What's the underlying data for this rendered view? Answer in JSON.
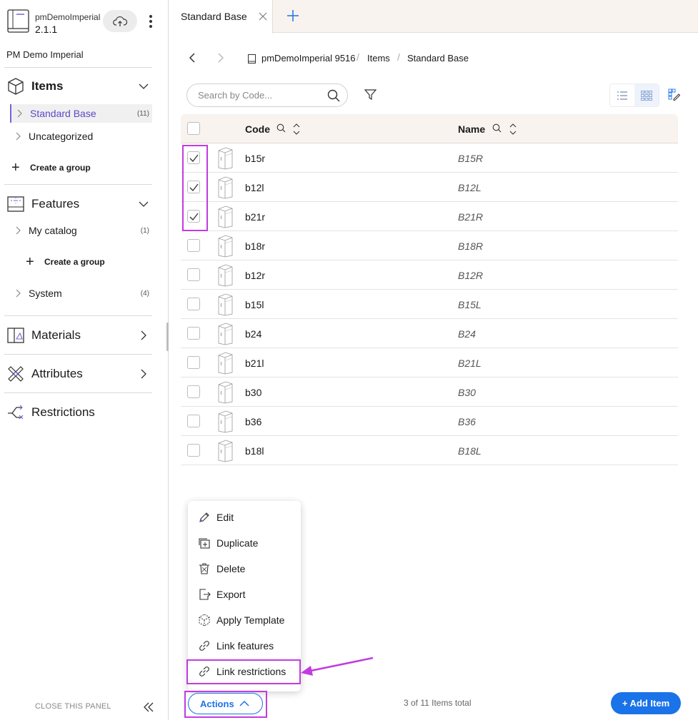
{
  "app": {
    "name": "pmDemoImperial",
    "version": "2.1.1",
    "catalog_name": "PM Demo Imperial"
  },
  "sidebar": {
    "sections": [
      {
        "id": "items",
        "label": "Items",
        "icon": "cube-icon",
        "expanded": true
      },
      {
        "id": "features",
        "label": "Features",
        "icon": "features-icon",
        "expanded": true
      },
      {
        "id": "materials",
        "label": "Materials",
        "icon": "materials-icon",
        "expanded": false
      },
      {
        "id": "attributes",
        "label": "Attributes",
        "icon": "attributes-icon",
        "expanded": false
      },
      {
        "id": "restrictions",
        "label": "Restrictions",
        "icon": "restrictions-icon"
      }
    ],
    "items_tree": [
      {
        "label": "Standard Base",
        "count": "(11)",
        "active": true
      },
      {
        "label": "Uncategorized",
        "count": ""
      }
    ],
    "features_tree": [
      {
        "label": "My catalog",
        "count": "(1)"
      },
      {
        "label": "System",
        "count": "(4)"
      }
    ],
    "create_group_label": "Create a group",
    "close_panel_label": "CLOSE THIS PANEL"
  },
  "tabs": [
    {
      "label": "Standard Base",
      "active": true
    }
  ],
  "breadcrumb": [
    "pmDemoImperial 9516",
    "Items",
    "Standard Base"
  ],
  "search": {
    "placeholder": "Search by Code..."
  },
  "table": {
    "columns": {
      "code": "Code",
      "name": "Name"
    },
    "rows": [
      {
        "code": "b15r",
        "name": "B15R",
        "checked": true
      },
      {
        "code": "b12l",
        "name": "B12L",
        "checked": true
      },
      {
        "code": "b21r",
        "name": "B21R",
        "checked": true
      },
      {
        "code": "b18r",
        "name": "B18R",
        "checked": false
      },
      {
        "code": "b12r",
        "name": "B12R",
        "checked": false
      },
      {
        "code": "b15l",
        "name": "B15L",
        "checked": false
      },
      {
        "code": "b24",
        "name": "B24",
        "checked": false
      },
      {
        "code": "b21l",
        "name": "B21L",
        "checked": false
      },
      {
        "code": "b30",
        "name": "B30",
        "checked": false
      },
      {
        "code": "b36",
        "name": "B36",
        "checked": false
      },
      {
        "code": "b18l",
        "name": "B18L",
        "checked": false
      }
    ]
  },
  "actions_menu": [
    {
      "label": "Edit",
      "icon": "pencil-icon"
    },
    {
      "label": "Duplicate",
      "icon": "duplicate-icon"
    },
    {
      "label": "Delete",
      "icon": "trash-icon"
    },
    {
      "label": "Export",
      "icon": "export-icon"
    },
    {
      "label": "Apply Template",
      "icon": "template-icon"
    },
    {
      "label": "Link features",
      "icon": "link-icon"
    },
    {
      "label": "Link restrictions",
      "icon": "link-icon"
    }
  ],
  "footer": {
    "actions_label": "Actions",
    "total_text": "3 of 11 Items total",
    "add_label": "+ Add Item"
  },
  "colors": {
    "accent": "#1a73e8",
    "highlight": "#c23be0",
    "active_nav": "#5e47c9",
    "header_bg": "#f8f3ef"
  }
}
